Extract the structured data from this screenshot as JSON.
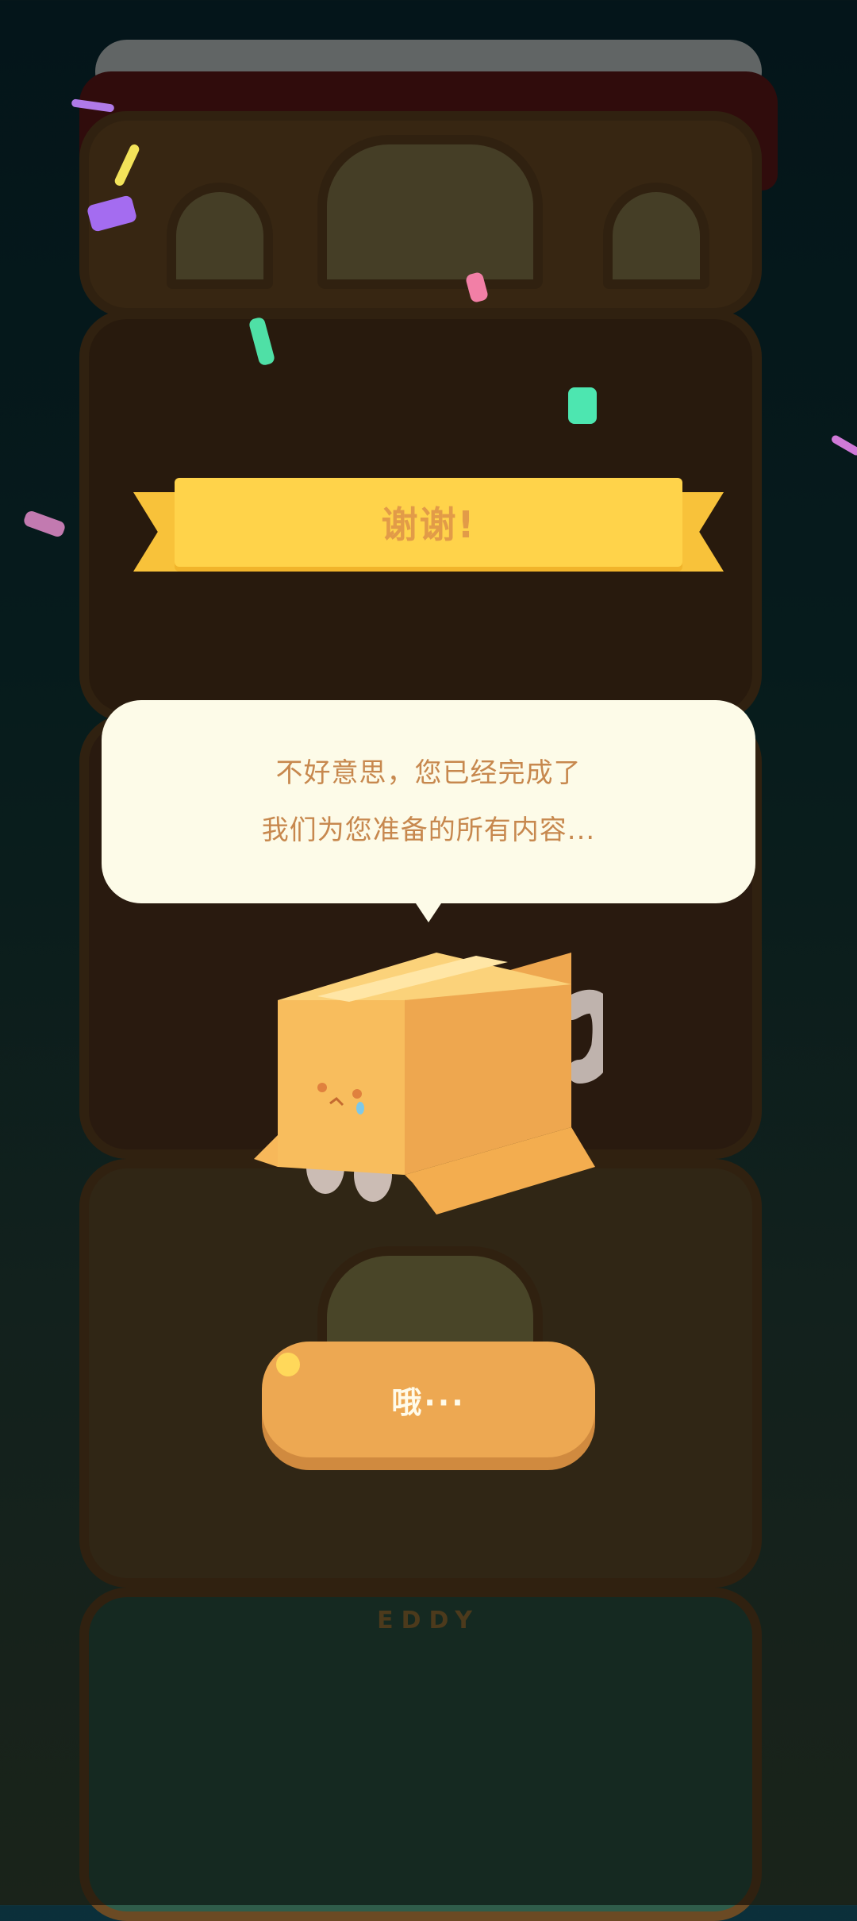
{
  "banner": {
    "title": "谢谢!"
  },
  "dialog": {
    "line1": "不好意思，您已经完成了",
    "line2": "我们为您准备的所有内容..."
  },
  "button": {
    "label": "哦···"
  },
  "sign": {
    "text": "EDDY"
  },
  "colors": {
    "banner": "#ffd34a",
    "banner_text": "#e29b48",
    "bubble": "#fdfbe8",
    "bubble_text": "#c7884e",
    "button": "#eda852",
    "button_text": "#fffbea"
  },
  "icons": [
    "confetti",
    "cardboard-box-cat"
  ]
}
